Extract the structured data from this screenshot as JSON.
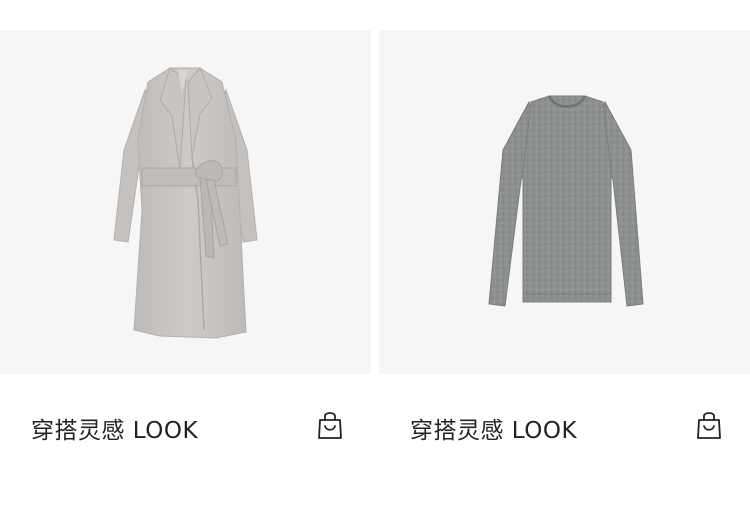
{
  "products": [
    {
      "name": "穿搭灵感 LOOK",
      "image_icon": "wrap-coat-image",
      "action_icon": "shopping-bag-icon"
    },
    {
      "name": "穿搭灵感 LOOK",
      "image_icon": "sweater-image",
      "action_icon": "shopping-bag-icon"
    }
  ],
  "colors": {
    "image_background": "#f6f6f6",
    "text": "#222222",
    "coat": "#c9c6c4",
    "sweater": "#8a8d8c"
  }
}
